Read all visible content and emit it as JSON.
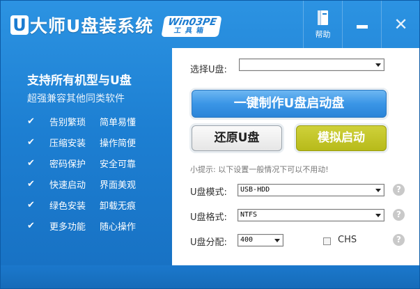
{
  "title": {
    "logo_letter": "U",
    "logo_text": "大师U盘装系统",
    "badge_top": "Win03PE",
    "badge_bottom": "工具箱"
  },
  "titlebar_buttons": {
    "help_label": "帮助"
  },
  "left_panel": {
    "slogan": "支持所有机型与U盘",
    "subslogan": "超强兼容其他同类软件",
    "features": [
      [
        "告别繁琐",
        "简单易懂"
      ],
      [
        "压缩安装",
        "操作简便"
      ],
      [
        "密码保护",
        "安全可靠"
      ],
      [
        "快速启动",
        "界面美观"
      ],
      [
        "绿色安装",
        "卸载无痕"
      ],
      [
        "更多功能",
        "随心操作"
      ]
    ]
  },
  "right_panel": {
    "select_usb_label": "选择U盘:",
    "select_usb_value": "",
    "make_boot_button": "一键制作U盘启动盘",
    "restore_button": "还原U盘",
    "simulate_button": "模拟启动",
    "tip": "小提示: 以下设置一般情况下可以不用动!",
    "mode_label": "U盘模式:",
    "mode_value": "USB-HDD",
    "format_label": "U盘格式:",
    "format_value": "NTFS",
    "partition_label": "U盘分配:",
    "partition_value": "400",
    "chs_label": "CHS",
    "chs_checked": false
  },
  "icons": {
    "help": "book-icon",
    "minimize": "minimize-icon",
    "close": "close-icon",
    "check": "check-icon",
    "question": "question-icon"
  },
  "colors": {
    "primary_blue": "#1d7fd2",
    "button_blue": "#3a95e6",
    "button_olive": "#b7ba1a"
  }
}
